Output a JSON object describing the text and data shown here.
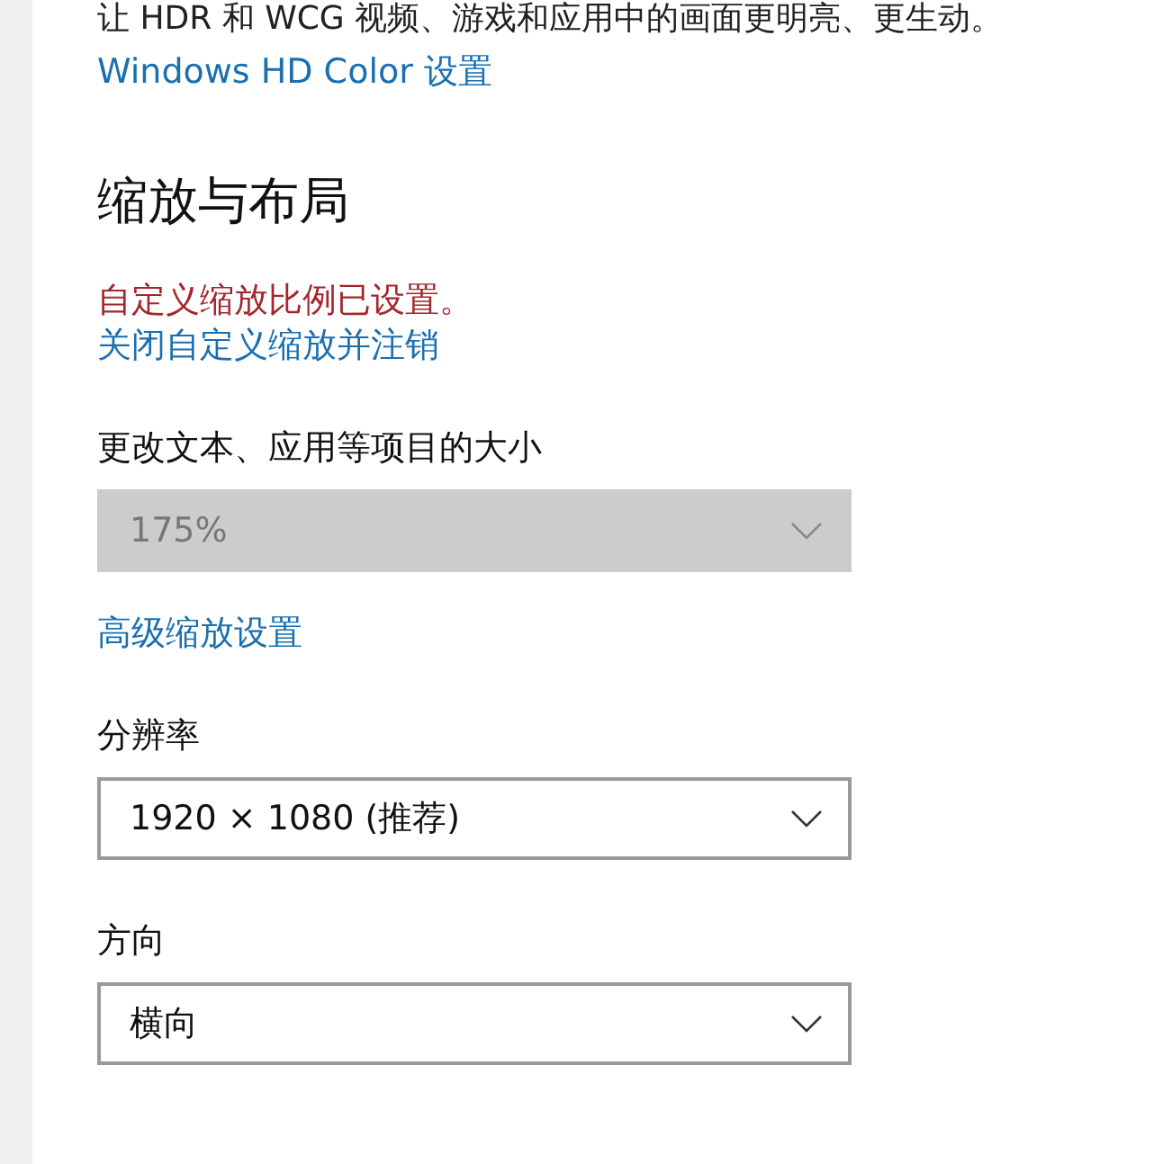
{
  "hdr": {
    "description": "让 HDR 和 WCG 视频、游戏和应用中的画面更明亮、更生动。",
    "link": "Windows HD Color 设置"
  },
  "scale_layout": {
    "title": "缩放与布局",
    "warning": "自定义缩放比例已设置。",
    "signout_link": "关闭自定义缩放并注销",
    "fields": [
      {
        "label": "更改文本、应用等项目的大小",
        "value": "175%",
        "disabled": true
      },
      {
        "kind": "link",
        "text": "高级缩放设置"
      },
      {
        "label": "分辨率",
        "value": "1920 × 1080 (推荐)",
        "disabled": false
      },
      {
        "label": "方向",
        "value": "横向",
        "disabled": false
      }
    ]
  }
}
